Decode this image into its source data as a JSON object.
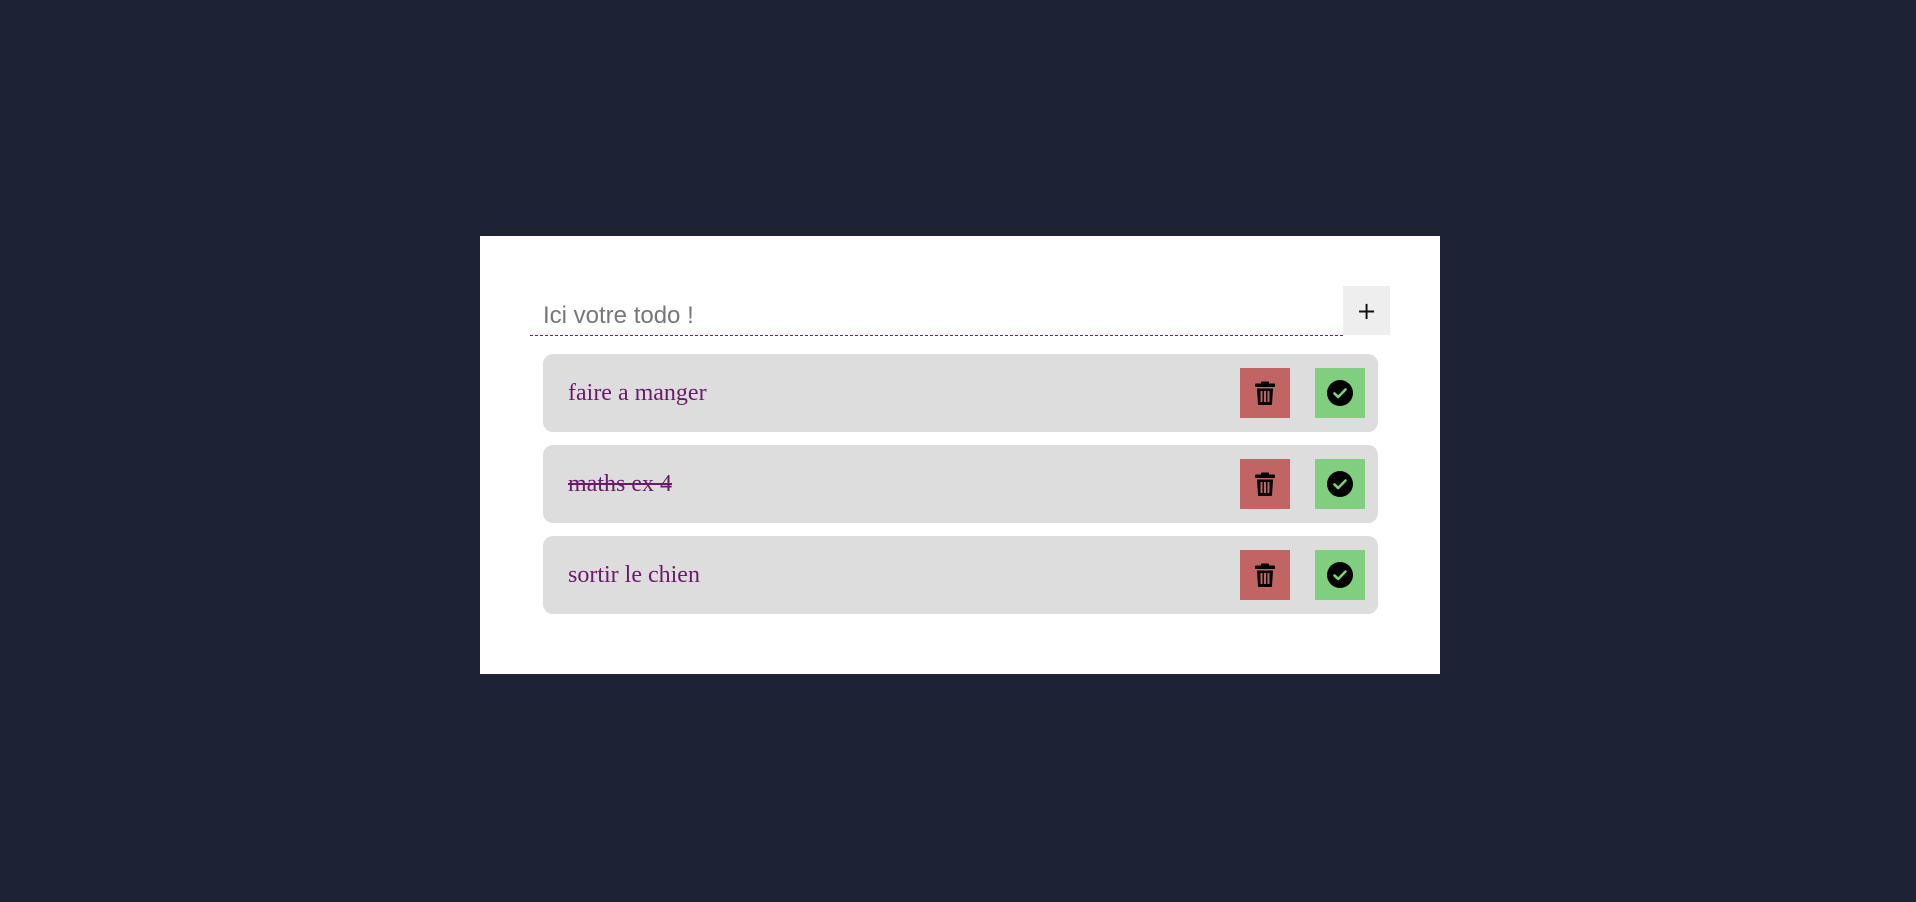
{
  "form": {
    "placeholder": "Ici votre todo !",
    "value": "",
    "add_label": "+"
  },
  "todos": [
    {
      "text": "faire a manger",
      "done": false,
      "delete_icon": "trash-icon",
      "complete_icon": "check-circle-icon"
    },
    {
      "text": "maths ex 4",
      "done": true,
      "delete_icon": "trash-icon",
      "complete_icon": "check-circle-icon"
    },
    {
      "text": "sortir le chien",
      "done": false,
      "delete_icon": "trash-icon",
      "complete_icon": "check-circle-icon"
    }
  ],
  "colors": {
    "background": "#1e2235",
    "card": "#ffffff",
    "item": "#dddddd",
    "text": "#6b1a6b",
    "delete": "#c06464",
    "complete": "#80cf7f"
  }
}
